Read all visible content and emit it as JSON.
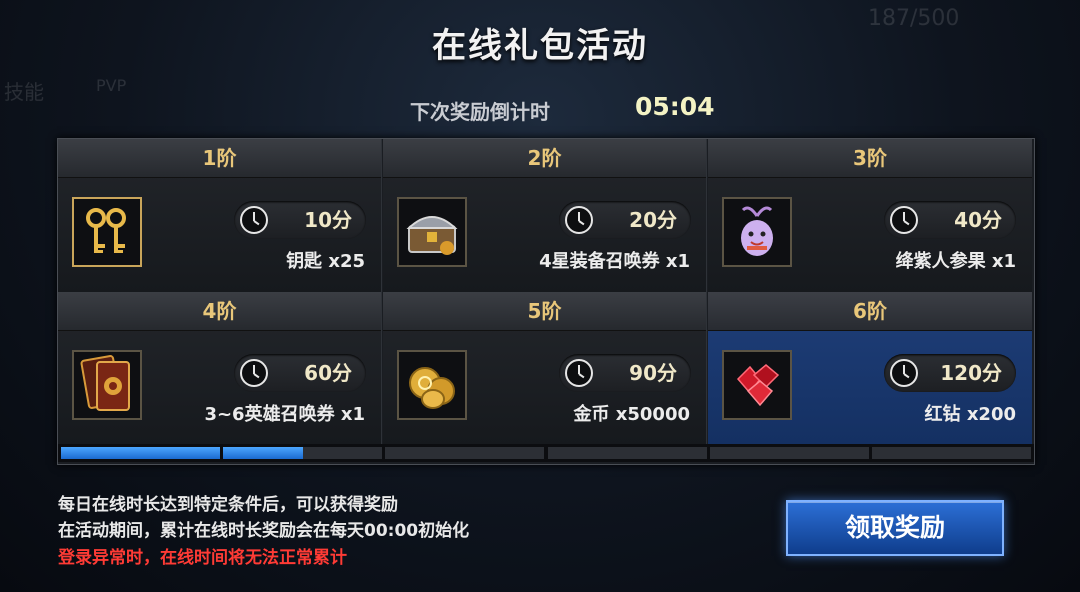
{
  "title": "在线礼包活动",
  "countdown": {
    "label": "下次奖励倒计时",
    "value": "05:04"
  },
  "bg_hint": {
    "counter": "187/500",
    "skill": "技能",
    "pvp": "PVP"
  },
  "tiers": [
    {
      "stage": "1阶",
      "time": "10分",
      "item": "钥匙 x25",
      "icon": "key-icon",
      "active": false
    },
    {
      "stage": "2阶",
      "time": "20分",
      "item": "4星装备召唤券 x1",
      "icon": "treasure-chest-icon",
      "active": false
    },
    {
      "stage": "3阶",
      "time": "40分",
      "item": "绛紫人参果 x1",
      "icon": "ginseng-fruit-icon",
      "active": false
    },
    {
      "stage": "4阶",
      "time": "60分",
      "item": "3~6英雄召唤券 x1",
      "icon": "hero-card-icon",
      "active": false
    },
    {
      "stage": "5阶",
      "time": "90分",
      "item": "金币 x50000",
      "icon": "gold-coins-icon",
      "active": false
    },
    {
      "stage": "6阶",
      "time": "120分",
      "item": "红钻 x200",
      "icon": "red-diamond-icon",
      "active": true
    }
  ],
  "progress": {
    "segments_filled": [
      1.0,
      0.5,
      0,
      0,
      0,
      0
    ],
    "fill_color": "#2b86f0"
  },
  "notes": {
    "line1": "每日在线时长达到特定条件后，可以获得奖励",
    "line2": "在活动期间，累计在线时长奖励会在每天00:00初始化",
    "warning": "登录异常时，在线时间将无法正常累计"
  },
  "claim_button": "领取奖励"
}
